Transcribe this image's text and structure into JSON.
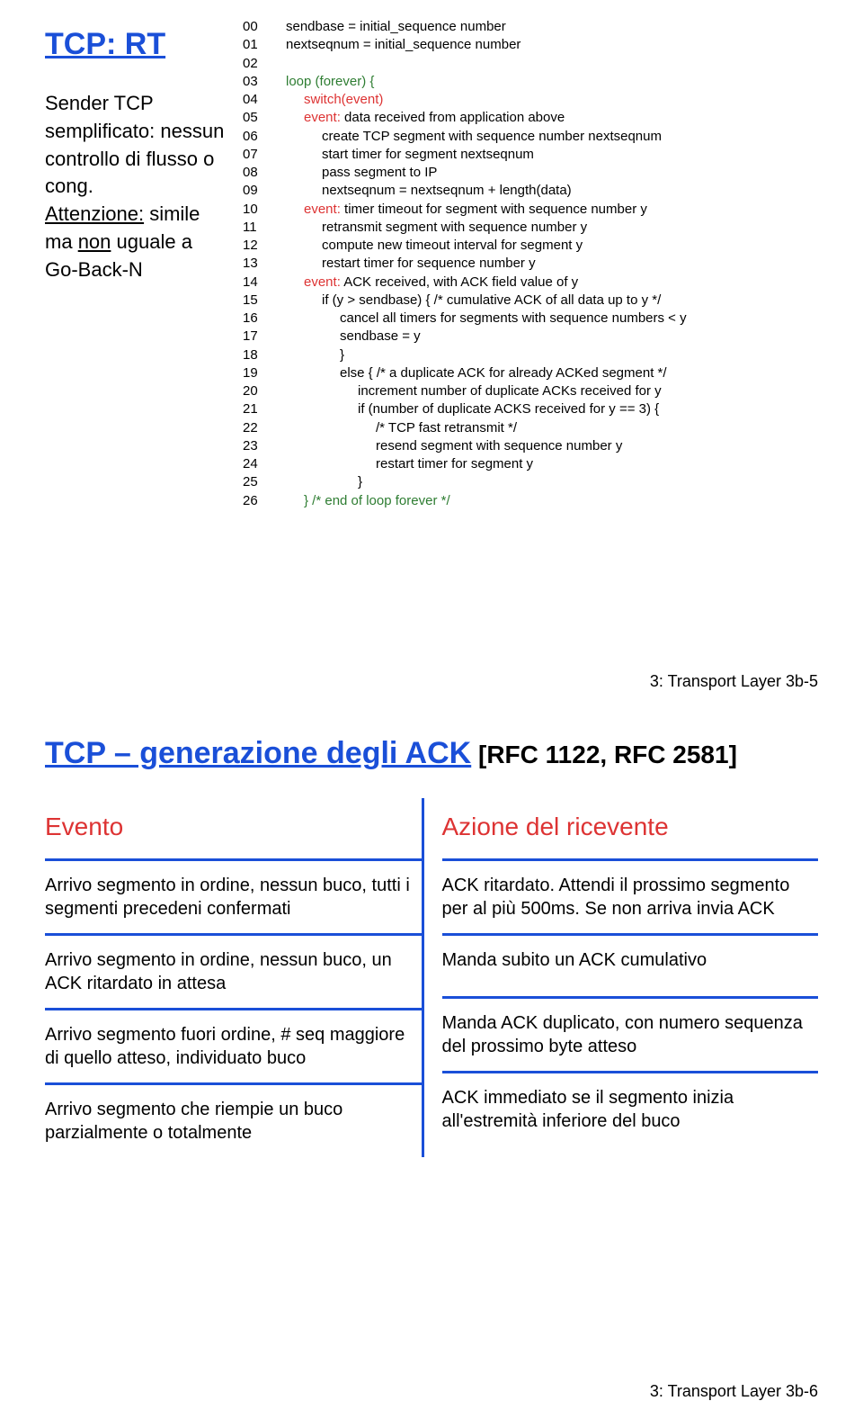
{
  "slide1": {
    "title": "TCP: RT",
    "sidebar_l1": "Sender TCP semplificato: nessun controllo di flusso o cong.",
    "sidebar_att": "Attenzione:",
    "sidebar_l2a": " simile ma ",
    "sidebar_non": "non",
    "sidebar_l2b": " uguale a Go-Back-N",
    "code": [
      {
        "n": "00",
        "cls": "i1",
        "txt": "sendbase = initial_sequence number"
      },
      {
        "n": "01",
        "cls": "i1",
        "txt": "nextseqnum = initial_sequence number"
      },
      {
        "n": "02",
        "cls": "i1",
        "txt": ""
      },
      {
        "n": "03",
        "cls": "i1",
        "txt": "loop (forever) {",
        "color": "green"
      },
      {
        "n": "04",
        "cls": "i2",
        "txt": "switch(event)",
        "color": "red"
      },
      {
        "n": "05",
        "cls": "i2",
        "txt_a": "event:",
        "txt_b": " data received from application above",
        "color_a": "red"
      },
      {
        "n": "06",
        "cls": "i3",
        "txt": "create TCP segment with sequence number nextseqnum"
      },
      {
        "n": "07",
        "cls": "i3",
        "txt": "start timer for segment nextseqnum"
      },
      {
        "n": "08",
        "cls": "i3",
        "txt": "pass segment to IP"
      },
      {
        "n": "09",
        "cls": "i3",
        "txt": "nextseqnum = nextseqnum + length(data)"
      },
      {
        "n": "10",
        "cls": "i2",
        "txt_a": "event:",
        "txt_b": " timer timeout for segment with sequence number y",
        "color_a": "red"
      },
      {
        "n": "11",
        "cls": "i3",
        "txt": "retransmit segment with sequence number y"
      },
      {
        "n": "12",
        "cls": "i3",
        "txt": "compute new timeout interval for segment y"
      },
      {
        "n": "13",
        "cls": "i3",
        "txt": "restart timer for sequence number y"
      },
      {
        "n": "14",
        "cls": "i2",
        "txt_a": "event:",
        "txt_b": " ACK received, with ACK field value of y",
        "color_a": "red"
      },
      {
        "n": "15",
        "cls": "i3",
        "txt": "if (y > sendbase) { /* cumulative ACK of all data up to y */"
      },
      {
        "n": "16",
        "cls": "i4",
        "txt": "cancel all timers for segments with sequence numbers < y"
      },
      {
        "n": "17",
        "cls": "i4",
        "txt": "sendbase = y"
      },
      {
        "n": "18",
        "cls": "i4",
        "txt": "}"
      },
      {
        "n": "19",
        "cls": "i4",
        "txt": "else { /* a duplicate ACK for already ACKed segment */"
      },
      {
        "n": "20",
        "cls": "i5",
        "txt": "increment number of duplicate ACKs received for y"
      },
      {
        "n": "21",
        "cls": "i5",
        "txt": "if (number of duplicate ACKS received for y == 3) {"
      },
      {
        "n": "22",
        "cls": "i6",
        "txt": "/* TCP fast retransmit */"
      },
      {
        "n": "23",
        "cls": "i6",
        "txt": "resend segment with sequence number y"
      },
      {
        "n": "24",
        "cls": "i6",
        "txt": "restart timer for segment y"
      },
      {
        "n": "25",
        "cls": "i5",
        "txt": "}"
      },
      {
        "n": "26",
        "cls": "i2",
        "txt": "} /* end of loop forever */",
        "color": "green"
      }
    ],
    "footer": "3: Transport Layer   3b-5"
  },
  "slide2": {
    "title_a": "TCP – generazione degli ACK",
    "title_b": " [RFC 1122, RFC 2581]",
    "hdr_left": "Evento",
    "hdr_right": "Azione del ricevente",
    "rows": [
      {
        "l": "Arrivo segmento in ordine, nessun buco, tutti i segmenti precedeni confermati",
        "r": "ACK ritardato. Attendi il prossimo segmento per al più 500ms. Se non arriva invia ACK"
      },
      {
        "l": "Arrivo segmento in ordine, nessun buco, un ACK ritardato in attesa",
        "r": "Manda subito un ACK cumulativo"
      },
      {
        "l": "Arrivo segmento fuori ordine, # seq maggiore di quello atteso, individuato buco",
        "r": "Manda ACK duplicato, con numero sequenza del prossimo byte atteso"
      },
      {
        "l": "Arrivo segmento che riempie un buco parzialmente o totalmente",
        "r": "ACK immediato se il segmento inizia all'estremità inferiore del buco"
      }
    ],
    "footer": "3: Transport Layer   3b-6"
  }
}
